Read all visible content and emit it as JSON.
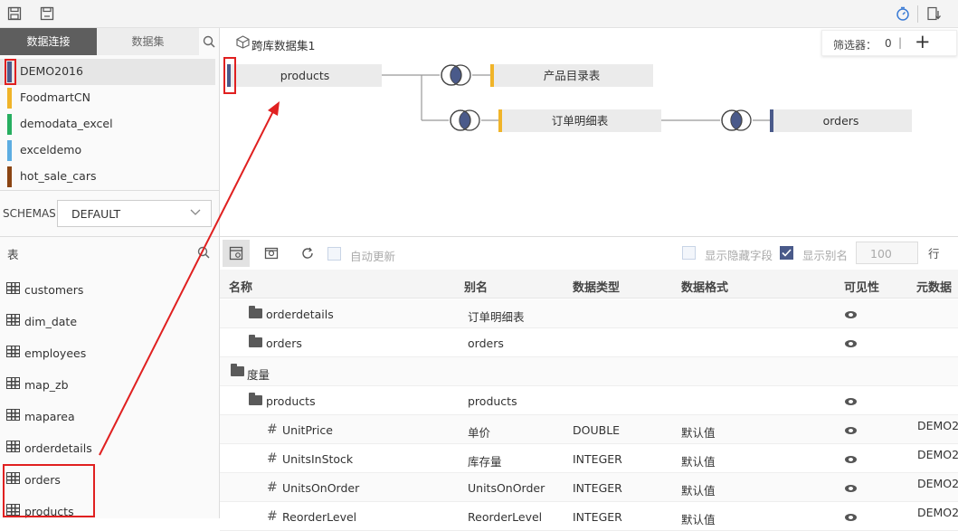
{
  "toolbar": {
    "icons": [
      "save-icon",
      "save-as-icon",
      "timer-icon",
      "export-icon"
    ]
  },
  "left_panel": {
    "tabs": [
      "数据连接",
      "数据集"
    ],
    "connections": [
      {
        "label": "DEMO2016",
        "color": "#4a5a8a"
      },
      {
        "label": "FoodmartCN",
        "color": "#f0b429"
      },
      {
        "label": "demodata_excel",
        "color": "#27ae60"
      },
      {
        "label": "exceldemo",
        "color": "#5dade2"
      },
      {
        "label": "hot_sale_cars",
        "color": "#8b4513"
      }
    ],
    "schemas_label": "SCHEMAS",
    "schemas_value": "DEFAULT",
    "tables_heading": "表",
    "tables": [
      "customers",
      "dim_date",
      "employees",
      "map_zb",
      "maparea",
      "orderdetails",
      "orders",
      "products"
    ]
  },
  "canvas": {
    "dataset_title": "跨库数据集1",
    "filter_label": "筛选器：",
    "filter_count": "0",
    "filter_sep": "|",
    "add_label": "+",
    "nodes": {
      "products": "products",
      "product_catalog": "产品目录表",
      "order_details": "订单明细表",
      "orders": "orders"
    }
  },
  "grid_toolbar": {
    "auto_update": "自动更新",
    "show_hidden": "显示隐藏字段",
    "show_alias": "显示别名",
    "rows_value": "100",
    "rows_unit": "行"
  },
  "grid": {
    "headers": [
      "名称",
      "别名",
      "数据类型",
      "数据格式",
      "可见性",
      "元数据"
    ],
    "rows": [
      {
        "kind": "folder",
        "name": "orderdetails",
        "alias": "订单明细表",
        "type": "",
        "format": "",
        "eye": true,
        "meta": ""
      },
      {
        "kind": "folder",
        "name": "orders",
        "alias": "orders",
        "type": "",
        "format": "",
        "eye": true,
        "meta": ""
      },
      {
        "kind": "group",
        "name": "度量",
        "alias": "",
        "type": "",
        "format": "",
        "eye": false,
        "meta": ""
      },
      {
        "kind": "folder",
        "name": "products",
        "alias": "products",
        "type": "",
        "format": "",
        "eye": true,
        "meta": ""
      },
      {
        "kind": "field",
        "name": "UnitPrice",
        "alias": "单价",
        "type": "DOUBLE",
        "format": "默认值",
        "eye": true,
        "meta": "DEMO2"
      },
      {
        "kind": "field",
        "name": "UnitsInStock",
        "alias": "库存量",
        "type": "INTEGER",
        "format": "默认值",
        "eye": true,
        "meta": "DEMO2"
      },
      {
        "kind": "field",
        "name": "UnitsOnOrder",
        "alias": "UnitsOnOrder",
        "type": "INTEGER",
        "format": "默认值",
        "eye": true,
        "meta": "DEMO2"
      },
      {
        "kind": "field",
        "name": "ReorderLevel",
        "alias": "ReorderLevel",
        "type": "INTEGER",
        "format": "默认值",
        "eye": true,
        "meta": "DEMO2"
      }
    ]
  },
  "colors": {
    "accent": "#3a7bd5",
    "annotation_red": "#e02020",
    "dark_node": "#4a5a8a",
    "yellow_node": "#f0b429"
  }
}
